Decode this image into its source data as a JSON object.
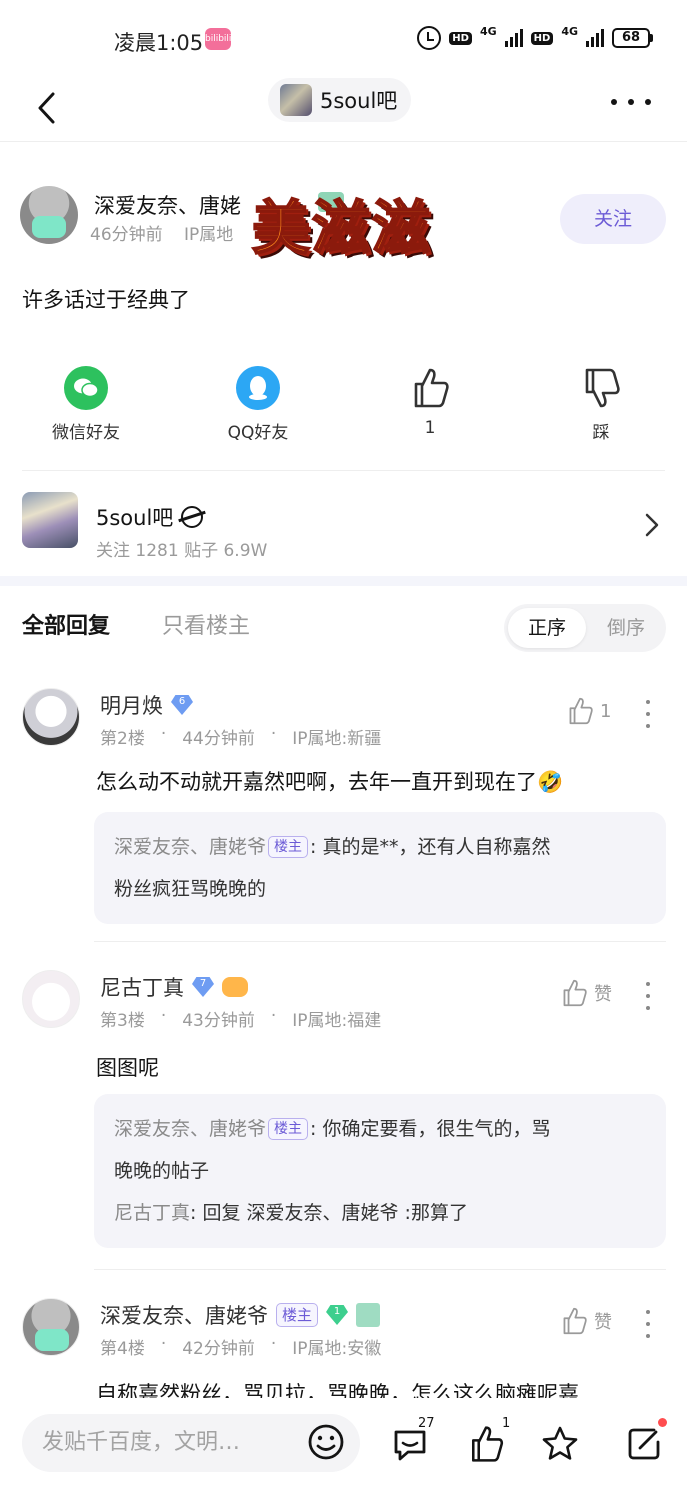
{
  "status_bar": {
    "time": "凌晨1:05",
    "app_badge": "bilibili",
    "hd1": "HD",
    "net1": "4G",
    "hd2": "HD",
    "net2": "4G",
    "battery": "68"
  },
  "nav": {
    "forum_name": "5soul吧"
  },
  "post": {
    "author_name": "深爱友奈、唐姥",
    "time_ago": "46分钟前",
    "ip_prefix": "IP属地",
    "follow_label": "关注",
    "sticker_text": "美滋滋",
    "body": "许多话过于经典了"
  },
  "actions": {
    "wechat_label": "微信好友",
    "qq_label": "QQ好友",
    "like_count": "1",
    "dislike_label": "踩"
  },
  "forum_card": {
    "name": "5soul吧",
    "stats": "关注 1281   贴子 6.9W"
  },
  "sort_bar": {
    "tab_all": "全部回复",
    "tab_owner": "只看楼主",
    "order_asc": "正序",
    "order_desc": "倒序"
  },
  "replies": [
    {
      "name": "明月焕",
      "level": "6",
      "floor": "第2楼",
      "time": "44分钟前",
      "ip": "IP属地:新疆",
      "likes": "1",
      "text": "怎么动不动就开嘉然吧啊，去年一直开到现在了🤣",
      "sub": [
        {
          "author": "深爱友奈、唐姥爷",
          "owner": "楼主",
          "text": ": 真的是**，还有人自称嘉然",
          "text2": "粉丝疯狂骂晚晚的"
        }
      ]
    },
    {
      "name": "尼古丁真",
      "level": "7",
      "floor": "第3楼",
      "time": "43分钟前",
      "ip": "IP属地:福建",
      "likes": "赞",
      "text": "图图呢",
      "sub": [
        {
          "author": "深爱友奈、唐姥爷",
          "owner": "楼主",
          "text": ": 你确定要看，很生气的，骂",
          "text2": "晚晚的帖子"
        },
        {
          "author": "尼古丁真",
          "text": ": 回复 深爱友奈、唐姥爷 :那算了"
        }
      ]
    },
    {
      "name": "深爱友奈、唐姥爷",
      "owner": "楼主",
      "level": "1",
      "floor": "第4楼",
      "time": "42分钟前",
      "ip": "IP属地:安徽",
      "likes": "赞",
      "text": "自称嘉然粉丝，骂贝拉，骂晚晚，怎么这么脑瘫呢嘉"
    }
  ],
  "bottom_bar": {
    "input_placeholder": "发贴千百度，文明…",
    "comment_count": "27",
    "like_count": "1"
  }
}
